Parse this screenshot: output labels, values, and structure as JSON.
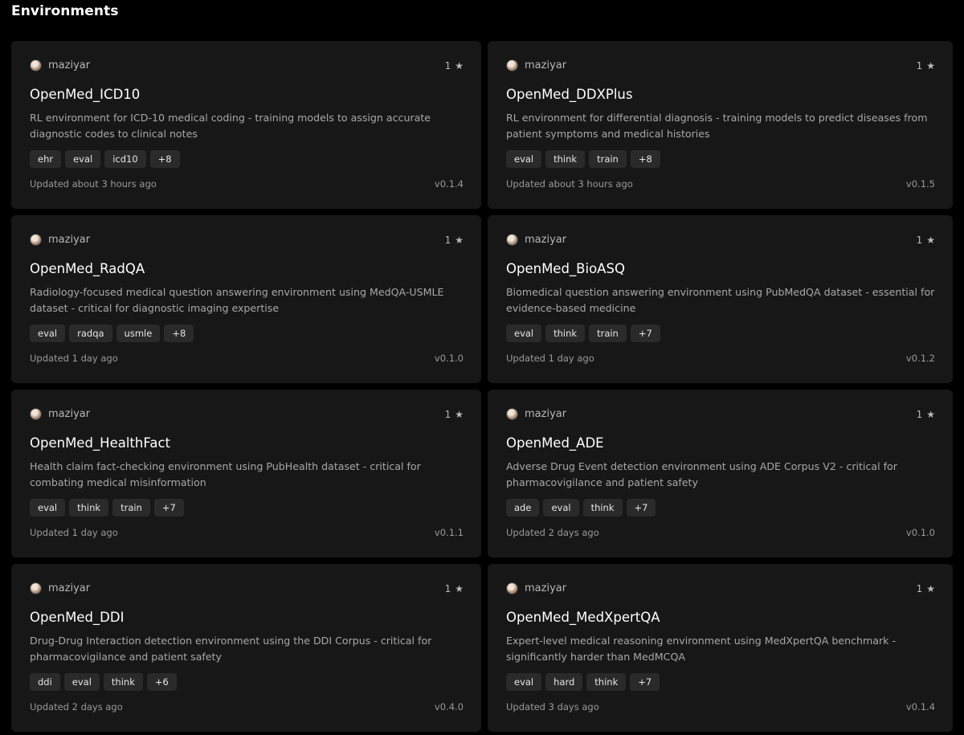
{
  "page": {
    "title": "Environments"
  },
  "environments": [
    {
      "author": "maziyar",
      "stars": "1",
      "title": "OpenMed_ICD10",
      "description": "RL environment for ICD-10 medical coding - training models to assign accurate diagnostic codes to clinical notes",
      "tags": [
        "ehr",
        "eval",
        "icd10",
        "+8"
      ],
      "updated": "Updated about 3 hours ago",
      "version": "v0.1.4"
    },
    {
      "author": "maziyar",
      "stars": "1",
      "title": "OpenMed_DDXPlus",
      "description": "RL environment for differential diagnosis - training models to predict diseases from patient symptoms and medical histories",
      "tags": [
        "eval",
        "think",
        "train",
        "+8"
      ],
      "updated": "Updated about 3 hours ago",
      "version": "v0.1.5"
    },
    {
      "author": "maziyar",
      "stars": "1",
      "title": "OpenMed_RadQA",
      "description": "Radiology-focused medical question answering environment using MedQA-USMLE dataset - critical for diagnostic imaging expertise",
      "tags": [
        "eval",
        "radqa",
        "usmle",
        "+8"
      ],
      "updated": "Updated 1 day ago",
      "version": "v0.1.0"
    },
    {
      "author": "maziyar",
      "stars": "1",
      "title": "OpenMed_BioASQ",
      "description": "Biomedical question answering environment using PubMedQA dataset - essential for evidence-based medicine",
      "tags": [
        "eval",
        "think",
        "train",
        "+7"
      ],
      "updated": "Updated 1 day ago",
      "version": "v0.1.2"
    },
    {
      "author": "maziyar",
      "stars": "1",
      "title": "OpenMed_HealthFact",
      "description": "Health claim fact-checking environment using PubHealth dataset - critical for combating medical misinformation",
      "tags": [
        "eval",
        "think",
        "train",
        "+7"
      ],
      "updated": "Updated 1 day ago",
      "version": "v0.1.1"
    },
    {
      "author": "maziyar",
      "stars": "1",
      "title": "OpenMed_ADE",
      "description": "Adverse Drug Event detection environment using ADE Corpus V2 - critical for pharmacovigilance and patient safety",
      "tags": [
        "ade",
        "eval",
        "think",
        "+7"
      ],
      "updated": "Updated 2 days ago",
      "version": "v0.1.0"
    },
    {
      "author": "maziyar",
      "stars": "1",
      "title": "OpenMed_DDI",
      "description": "Drug-Drug Interaction detection environment using the DDI Corpus - critical for pharmacovigilance and patient safety",
      "tags": [
        "ddi",
        "eval",
        "think",
        "+6"
      ],
      "updated": "Updated 2 days ago",
      "version": "v0.4.0"
    },
    {
      "author": "maziyar",
      "stars": "1",
      "title": "OpenMed_MedXpertQA",
      "description": "Expert-level medical reasoning environment using MedXpertQA benchmark - significantly harder than MedMCQA",
      "tags": [
        "eval",
        "hard",
        "think",
        "+7"
      ],
      "updated": "Updated 3 days ago",
      "version": "v0.1.4"
    }
  ],
  "icons": {
    "star": "star-icon",
    "avatar": "avatar"
  },
  "colors": {
    "background": "#000000",
    "card": "#171717",
    "tag": "#2a2a2a"
  }
}
